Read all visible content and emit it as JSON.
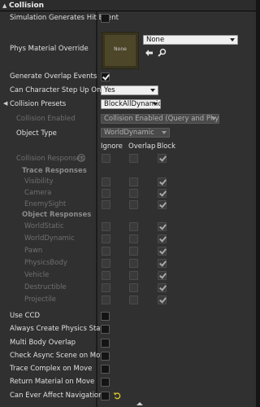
{
  "header": {
    "title": "Collision"
  },
  "rows": {
    "sim_hit": "Simulation Generates Hit Event",
    "phys_mat": "Phys Material Override",
    "gen_overlap": "Generate Overlap Events",
    "step_up": "Can Character Step Up On",
    "presets": "Collision Presets",
    "coll_enabled": "Collision Enabled",
    "obj_type": "Object Type",
    "coll_resp": "Collision Responses",
    "trace_resp": "Trace Responses",
    "object_resp": "Object Responses",
    "use_ccd": "Use CCD",
    "always_phys": "Always Create Physics State",
    "multi_body": "Multi Body Overlap",
    "check_async": "Check Async Scene on Move",
    "trace_complex": "Trace Complex on Move",
    "return_mat": "Return Material on Move",
    "nav": "Can Ever Affect Navigation"
  },
  "values": {
    "phys_mat_combo": "None",
    "thumb_label": "None",
    "step_up": "Yes",
    "presets": "BlockAllDynamic",
    "coll_enabled": "Collision Enabled (Query and Physics)",
    "obj_type": "WorldDynamic"
  },
  "columns": {
    "ignore": "Ignore",
    "overlap": "Overlap",
    "block": "Block"
  },
  "channels": {
    "trace": [
      "Visibility",
      "Camera",
      "EnemySight"
    ],
    "object": [
      "WorldStatic",
      "WorldDynamic",
      "Pawn",
      "PhysicsBody",
      "Vehicle",
      "Destructible",
      "Projectile"
    ]
  },
  "checks": {
    "sim_hit": false,
    "gen_overlap": true,
    "use_ccd": false,
    "always_phys": false,
    "multi_body": false,
    "check_async": false,
    "trace_complex": false,
    "return_mat": false,
    "nav": false
  }
}
